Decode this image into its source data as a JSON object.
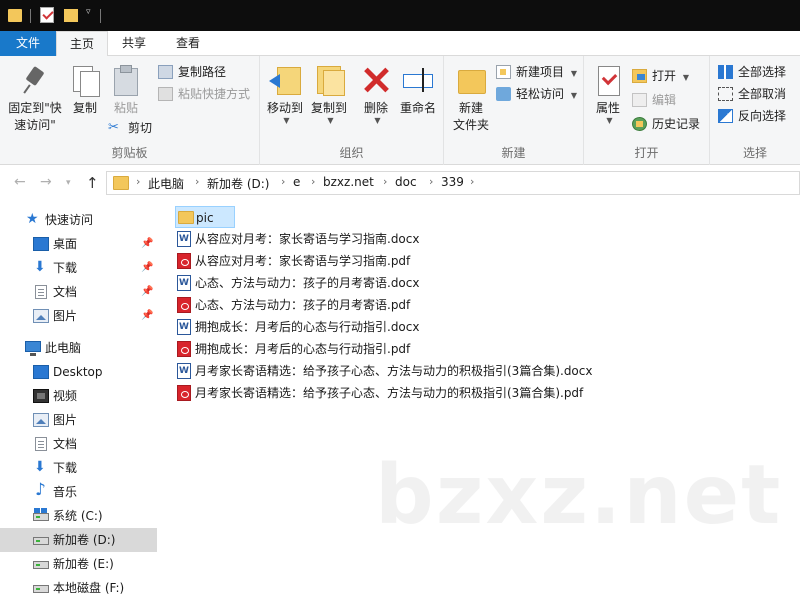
{
  "tabs": {
    "file": "文件",
    "home": "主页",
    "share": "共享",
    "view": "查看"
  },
  "ribbon": {
    "clipboard": {
      "label": "剪贴板",
      "pin_line1": "固定到\"快",
      "pin_line2": "速访问\"",
      "copy": "复制",
      "paste": "粘贴",
      "copy_path": "复制路径",
      "paste_shortcut": "粘贴快捷方式",
      "cut": "剪切"
    },
    "organize": {
      "label": "组织",
      "move_to": "移动到",
      "copy_to": "复制到",
      "delete": "删除",
      "rename": "重命名"
    },
    "new": {
      "label": "新建",
      "new_folder_line1": "新建",
      "new_folder_line2": "文件夹",
      "new_item": "新建项目",
      "easy_access": "轻松访问"
    },
    "open": {
      "label": "打开",
      "properties": "属性",
      "open": "打开",
      "edit": "编辑",
      "history": "历史记录"
    },
    "select": {
      "label": "选择",
      "select_all": "全部选择",
      "select_none": "全部取消",
      "invert": "反向选择"
    }
  },
  "address": {
    "crumbs": [
      "此电脑",
      "新加卷 (D:)",
      "e",
      "bzxz.net",
      "doc",
      "339"
    ]
  },
  "nav": {
    "quick_access": "快速访问",
    "desktop": "桌面",
    "downloads": "下载",
    "documents": "文档",
    "pictures": "图片",
    "this_pc": "此电脑",
    "pc_desktop": "Desktop",
    "videos": "视频",
    "pc_pictures": "图片",
    "pc_documents": "文档",
    "pc_downloads": "下载",
    "music": "音乐",
    "drive_c": "系统 (C:)",
    "drive_d": "新加卷 (D:)",
    "drive_e": "新加卷 (E:)",
    "drive_f": "本地磁盘 (F:)"
  },
  "files": [
    {
      "name": "pic",
      "type": "folder"
    },
    {
      "name": "从容应对月考：家长寄语与学习指南.docx",
      "type": "docx"
    },
    {
      "name": "从容应对月考：家长寄语与学习指南.pdf",
      "type": "pdf"
    },
    {
      "name": "心态、方法与动力：孩子的月考寄语.docx",
      "type": "docx"
    },
    {
      "name": "心态、方法与动力：孩子的月考寄语.pdf",
      "type": "pdf"
    },
    {
      "name": "拥抱成长：月考后的心态与行动指引.docx",
      "type": "docx"
    },
    {
      "name": "拥抱成长：月考后的心态与行动指引.pdf",
      "type": "pdf"
    },
    {
      "name": "月考家长寄语精选：给予孩子心态、方法与动力的积极指引(3篇合集).docx",
      "type": "docx"
    },
    {
      "name": "月考家长寄语精选：给予孩子心态、方法与动力的积极指引(3篇合集).pdf",
      "type": "pdf"
    }
  ],
  "watermark": "bzxz.net"
}
